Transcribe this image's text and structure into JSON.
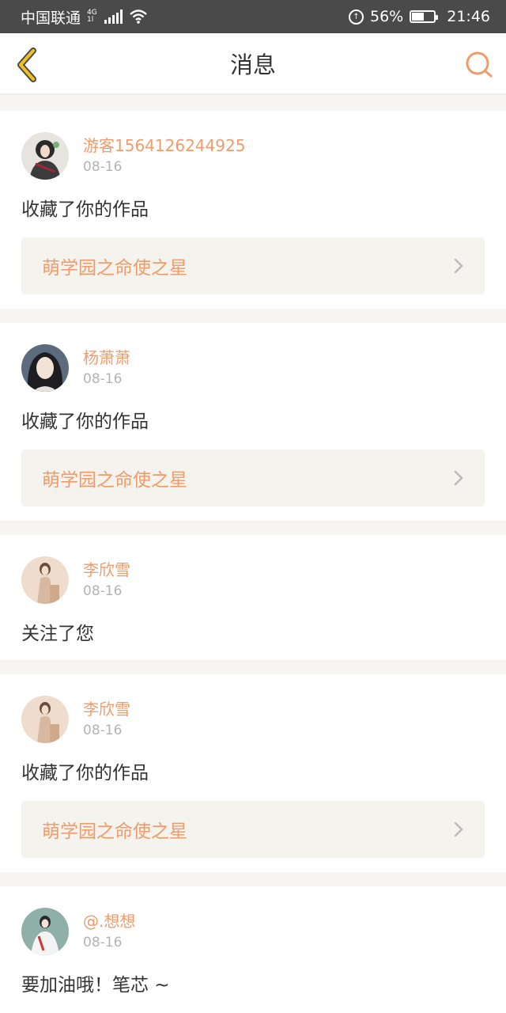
{
  "status_bar": {
    "carrier": "中国联通",
    "network_top": "4G",
    "network_bottom": "1l",
    "battery_percent": "56%",
    "battery_level": 0.56,
    "time": "21:46"
  },
  "header": {
    "title": "消息",
    "back_icon": "chevron-left-icon",
    "search_icon": "search-icon"
  },
  "colors": {
    "accent": "#f09c6a",
    "back_arrow": "#f0c21f",
    "link_bg": "#f4f3ee"
  },
  "messages": [
    {
      "username": "游客1564126244925",
      "date": "08-16",
      "action": "收藏了你的作品",
      "work_title": "萌学园之命使之星",
      "avatar": "avatar-1"
    },
    {
      "username": "杨萧萧",
      "date": "08-16",
      "action": "收藏了你的作品",
      "work_title": "萌学园之命使之星",
      "avatar": "avatar-2"
    },
    {
      "username": "李欣雪",
      "date": "08-16",
      "action": "关注了您",
      "avatar": "avatar-3"
    },
    {
      "username": "李欣雪",
      "date": "08-16",
      "action": "收藏了你的作品",
      "work_title": "萌学园之命使之星",
      "avatar": "avatar-3"
    },
    {
      "username": "@.想想",
      "date": "08-16",
      "action": "要加油哦！笔芯 ~",
      "avatar": "avatar-4"
    }
  ]
}
